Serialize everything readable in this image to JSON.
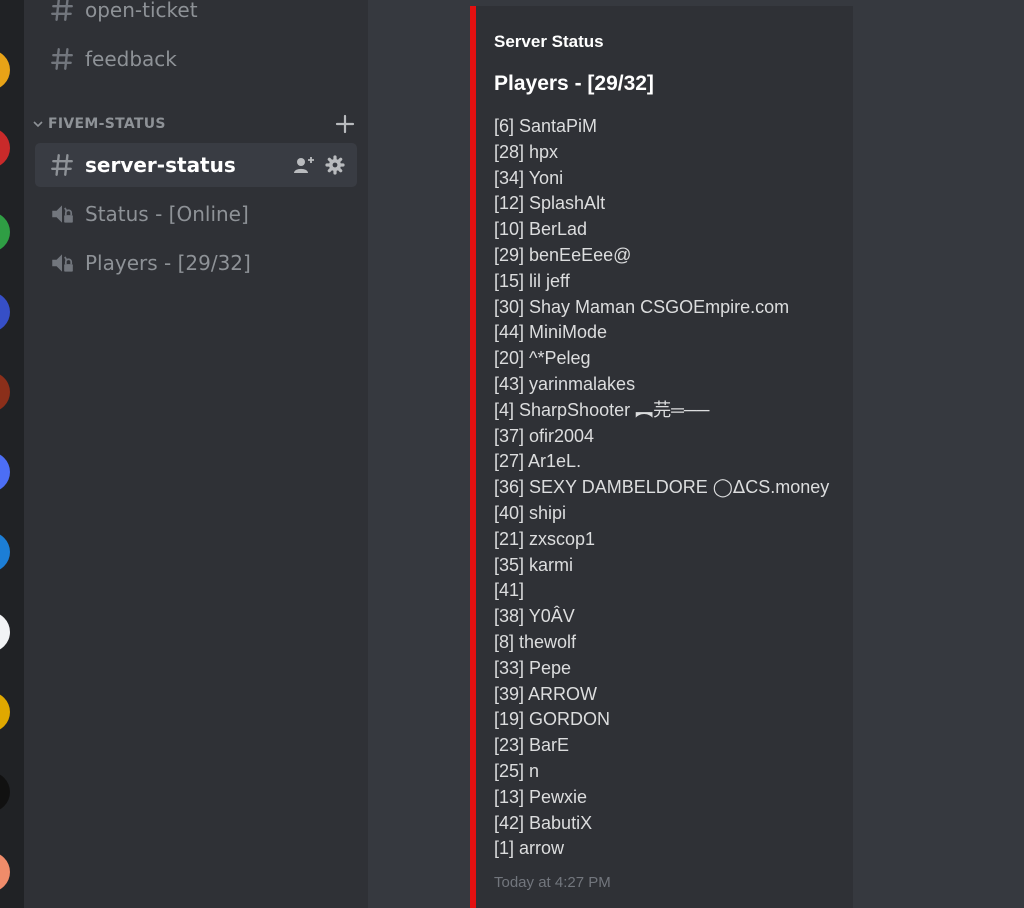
{
  "colors": {
    "server_rail": "#202225",
    "sidebar": "#2f3136",
    "chat_bg": "#36393f",
    "embed_accent": "#e31010",
    "selected_channel": "#393c43",
    "muted_text": "#8e9297",
    "message_text": "#dcddde",
    "white": "#ffffff",
    "timestamp": "#72767d"
  },
  "sidebar": {
    "channels_top": [
      {
        "type": "text",
        "icon": "hash-icon",
        "label": "open-ticket"
      },
      {
        "type": "text",
        "icon": "hash-icon",
        "label": "feedback"
      }
    ],
    "category": {
      "label": "FIVEM-STATUS",
      "icon": "chevron-down-icon",
      "action_icon": "plus-icon"
    },
    "category_channels": [
      {
        "type": "text",
        "icon": "hash-icon",
        "label": "server-status",
        "selected": true,
        "actions": [
          "add-member-icon",
          "gear-icon"
        ]
      },
      {
        "type": "voice",
        "icon": "speaker-lock-icon",
        "label": "Status - [Online]"
      },
      {
        "type": "voice",
        "icon": "speaker-lock-icon",
        "label": "Players - [29/32]"
      }
    ]
  },
  "embed": {
    "author": "Server Status",
    "title": "Players - [29/32]",
    "players": [
      "[6] SantaPiM",
      "[28] hpx",
      "[34] Yoni",
      "[12] SplashAlt",
      "[10] BerLad",
      "[29] benEeEee@",
      "[15] lil jeff",
      "[30] Shay Maman CSGOEmpire.com",
      "[44] MiniMode",
      "[20] ^*Peleg",
      "[43] yarinmalakes",
      "[4] SharpShooter ︻芫═──",
      "[37] ofir2004",
      "[27] Ar1eL.",
      "[36] SEXY DAMBELDORE ◯ᐃCS.money",
      "[40] shipi",
      "[21] zxscop1",
      "[35] karmi",
      "[41]",
      "[38] Y0ÂV",
      "[8] thewolf",
      "[33] Pepe",
      "[39] ARROW",
      "[19] GORDON",
      "[23] BarE",
      "[25] n",
      "[13] Pewxie",
      "[42] BabutiX",
      "[1] arrow"
    ],
    "footer": "Today at 4:27 PM"
  }
}
